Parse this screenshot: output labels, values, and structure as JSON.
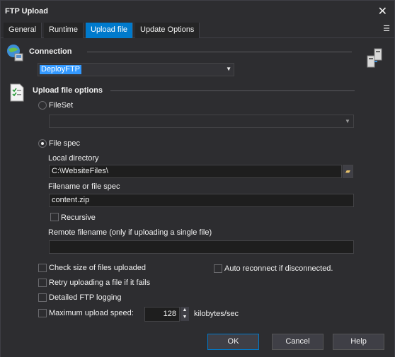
{
  "window": {
    "title": "FTP Upload",
    "close": "✕"
  },
  "tabs": [
    "General",
    "Runtime",
    "Upload file",
    "Update Options"
  ],
  "tabs_menu": "☰",
  "connection": {
    "section": "Connection",
    "value": "DeployFTP"
  },
  "upload": {
    "section": "Upload file options",
    "fileset_label": "FileSet",
    "fileset_value": "",
    "filespec_label": "File spec",
    "local_dir_label": "Local directory",
    "local_dir_value": "C:\\WebsiteFiles\\",
    "filename_label": "Filename or file spec",
    "filename_value": "content.zip",
    "recursive_label": "Recursive",
    "remote_label": "Remote filename (only if uploading a single file)",
    "remote_value": ""
  },
  "options": {
    "check_size": "Check size of files uploaded",
    "auto_reconnect": "Auto reconnect if disconnected.",
    "retry": "Retry uploading a file if it fails",
    "detailed_logging": "Detailed FTP logging",
    "max_speed": "Maximum upload speed:",
    "speed_value": "128",
    "speed_unit": "kilobytes/sec"
  },
  "buttons": {
    "ok": "OK",
    "cancel": "Cancel",
    "help": "Help"
  }
}
